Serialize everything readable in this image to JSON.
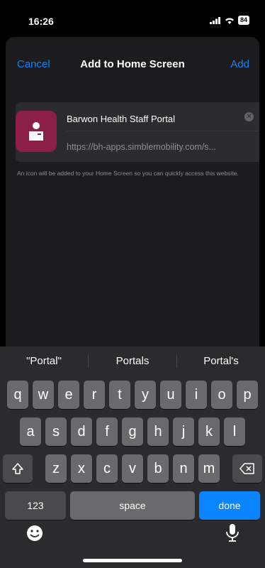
{
  "status_bar": {
    "time": "16:26",
    "battery": "84"
  },
  "nav": {
    "cancel": "Cancel",
    "title": "Add to Home Screen",
    "add": "Add"
  },
  "app": {
    "name": "Barwon Health Staff Portal",
    "url": "https://bh-apps.simblemobility.com/s..."
  },
  "hint": "An icon will be added to your Home Screen so you can quickly access this website.",
  "keyboard": {
    "suggestions": [
      "\"Portal\"",
      "Portals",
      "Portal's"
    ],
    "row1": [
      "q",
      "w",
      "e",
      "r",
      "t",
      "y",
      "u",
      "i",
      "o",
      "p"
    ],
    "row2": [
      "a",
      "s",
      "d",
      "f",
      "g",
      "h",
      "j",
      "k",
      "l"
    ],
    "row3": [
      "z",
      "x",
      "c",
      "v",
      "b",
      "n",
      "m"
    ],
    "numbers_label": "123",
    "space_label": "space",
    "done_label": "done"
  }
}
